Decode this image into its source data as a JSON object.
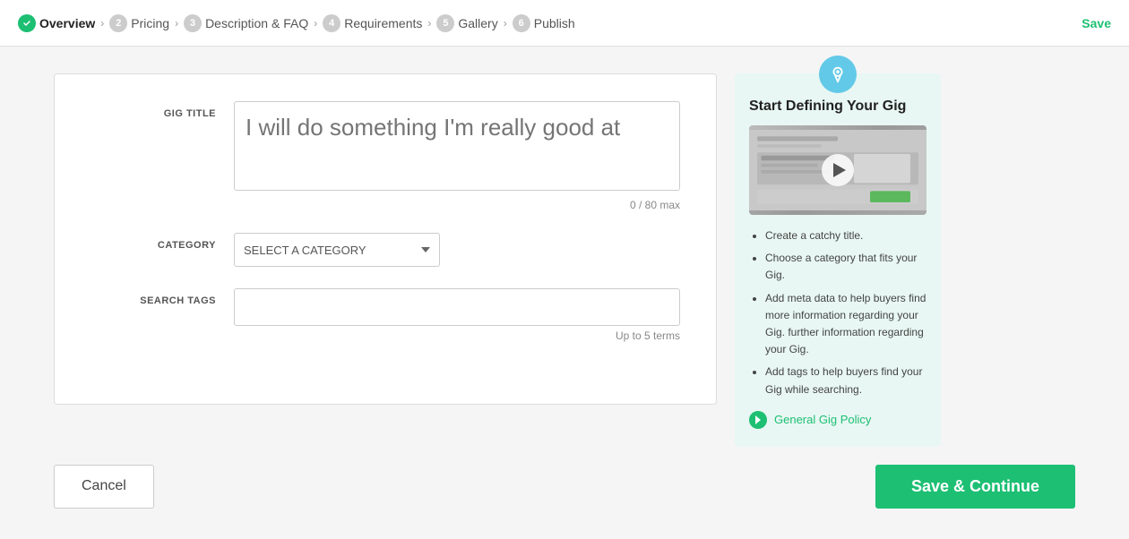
{
  "nav": {
    "steps": [
      {
        "number": null,
        "label": "Overview",
        "active": true,
        "first": true
      },
      {
        "number": "2",
        "label": "Pricing",
        "active": false
      },
      {
        "number": "3",
        "label": "Description & FAQ",
        "active": false
      },
      {
        "number": "4",
        "label": "Requirements",
        "active": false
      },
      {
        "number": "5",
        "label": "Gallery",
        "active": false
      },
      {
        "number": "6",
        "label": "Publish",
        "active": false
      }
    ],
    "save_label": "Save"
  },
  "form": {
    "gig_title_label": "GIG TITLE",
    "gig_title_placeholder": "I will do something I'm really good at",
    "gig_title_char_count": "0 / 80 max",
    "category_label": "CATEGORY",
    "category_placeholder": "SELECT A CATEGORY",
    "search_tags_label": "SEARCH TAGS",
    "search_tags_hint": "Up to 5 terms"
  },
  "buttons": {
    "cancel": "Cancel",
    "save_continue": "Save & Continue"
  },
  "side_panel": {
    "title": "Start Defining Your Gig",
    "tips": [
      "Create a catchy title.",
      "Choose a category that fits your Gig.",
      "Add meta data to help buyers find more information regarding your Gig. further information regarding your Gig.",
      "Add tags to help buyers find your Gig while searching."
    ],
    "policy_link": "General Gig Policy"
  }
}
